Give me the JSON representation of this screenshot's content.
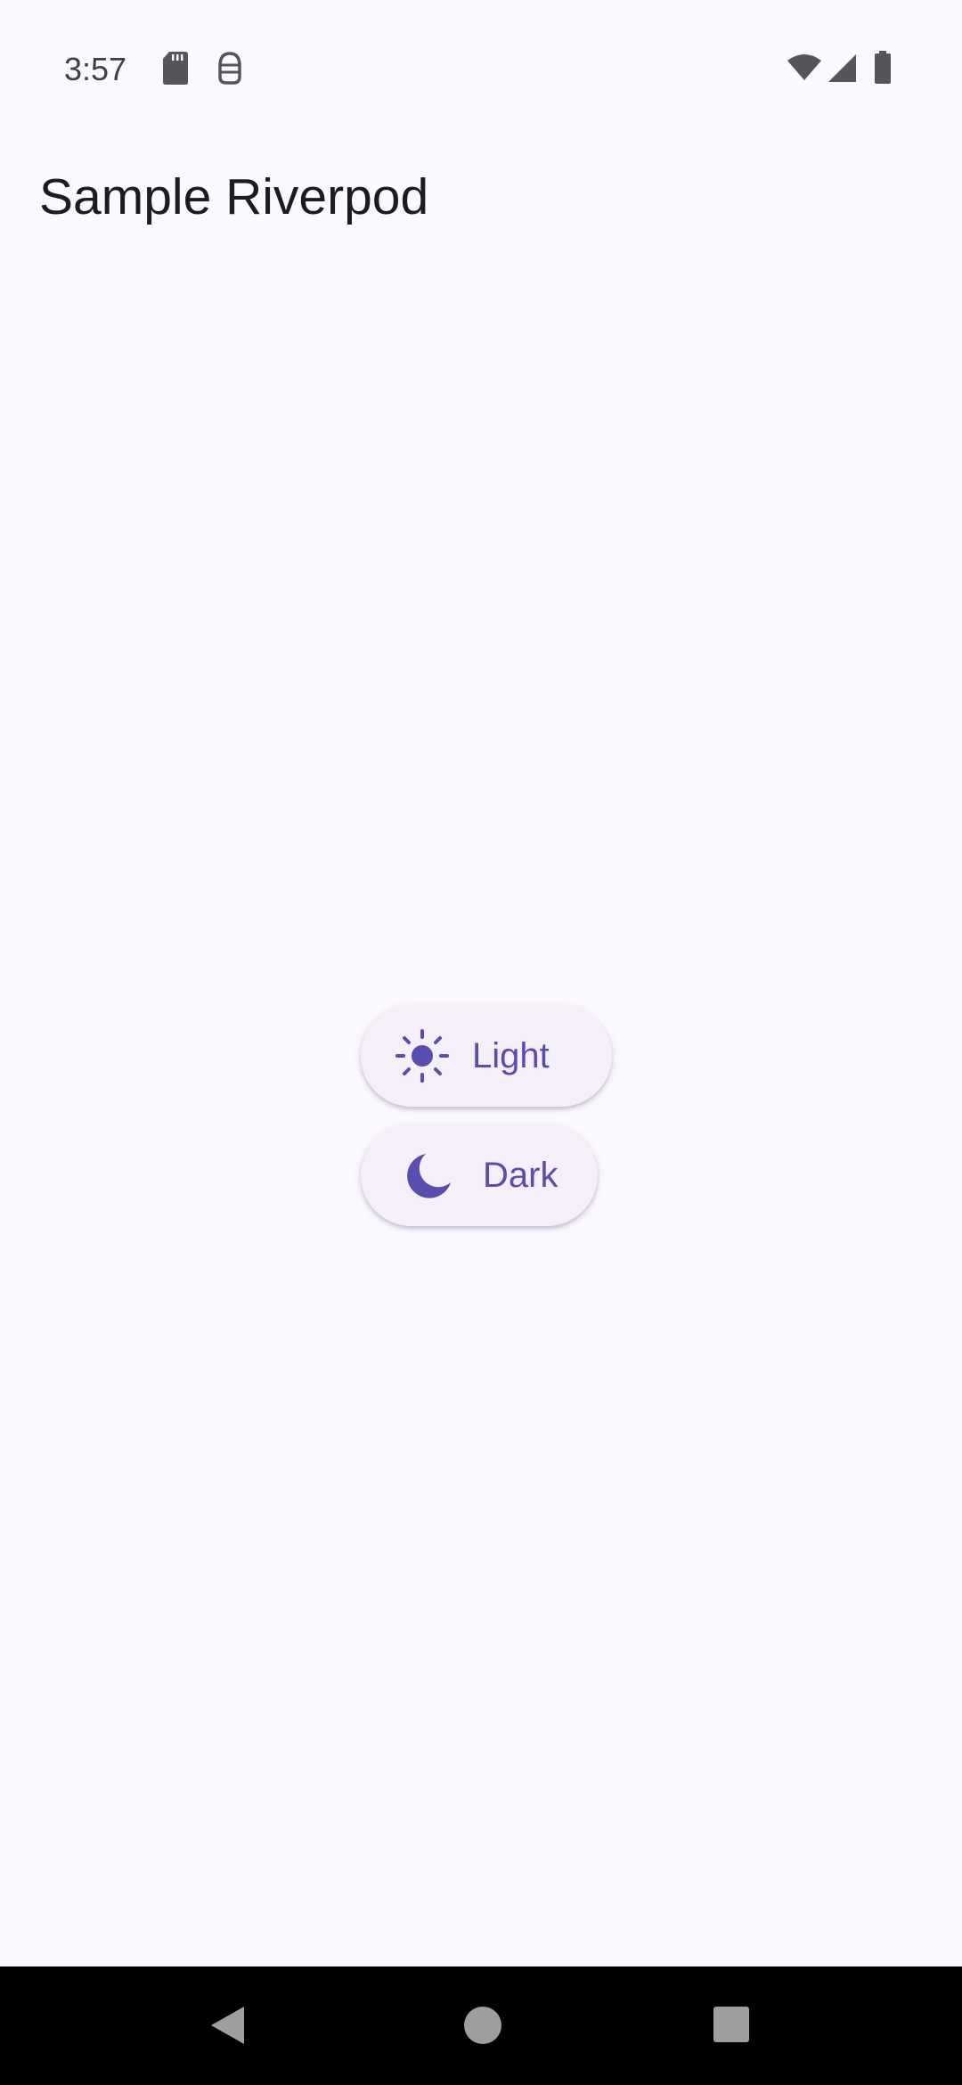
{
  "status_bar": {
    "time": "3:57",
    "left_icons": [
      "sd-card-icon",
      "android-debug-icon"
    ],
    "right_icons": [
      "wifi-icon",
      "signal-icon",
      "battery-icon"
    ]
  },
  "app_bar": {
    "title": "Sample Riverpod"
  },
  "theme_buttons": [
    {
      "label": "Light",
      "icon": "sun-icon"
    },
    {
      "label": "Dark",
      "icon": "moon-icon"
    }
  ],
  "nav_bar": {
    "buttons": [
      "back-icon",
      "home-icon",
      "recents-icon"
    ]
  },
  "colors": {
    "background": "#fbf8fe",
    "button_background": "#f4eff9",
    "accent": "#5a4db0",
    "title_text": "#1c1b1f",
    "nav_background": "#000000"
  }
}
